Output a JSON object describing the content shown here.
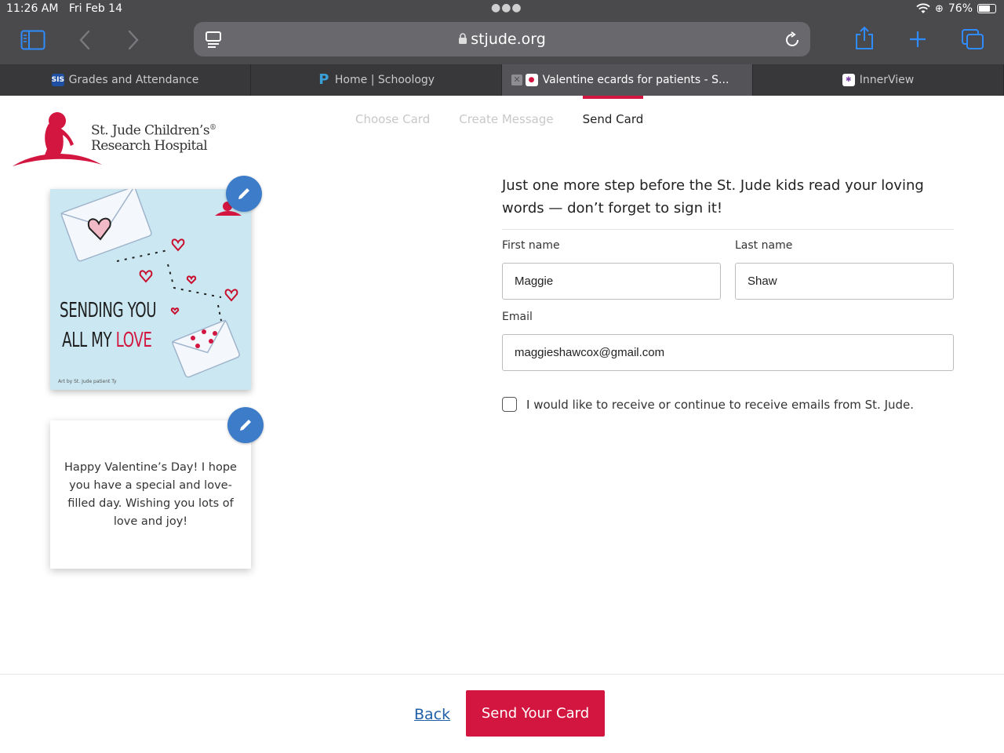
{
  "status": {
    "time": "11:26 AM",
    "date": "Fri Feb 14",
    "battery": "76%",
    "battery_level": 0.76
  },
  "browser": {
    "url": "stjude.org"
  },
  "tabs": [
    {
      "label": "Grades and Attendance",
      "favicon": "SIS"
    },
    {
      "label": "Home | Schoology",
      "favicon": "P"
    },
    {
      "label": "Valentine ecards for patients - S...",
      "favicon": "st-jude-icon",
      "active": true
    },
    {
      "label": "InnerView",
      "favicon": "innerview-icon"
    }
  ],
  "logo": {
    "line1": "St. Jude Children’s",
    "line2": "Research Hospital",
    "mark": "®"
  },
  "steps": [
    {
      "label": "Choose Card"
    },
    {
      "label": "Create Message"
    },
    {
      "label": "Send Card",
      "current": true
    }
  ],
  "card": {
    "art_line1": "SENDING YOU",
    "art_line2_a": "ALL MY ",
    "art_line2_b": "LOVE",
    "art_credit": "Art by St. Jude patient Ty",
    "message": "Happy Valentine’s Day! I hope you have a special and love-filled day. Wishing you lots of love and joy!"
  },
  "form": {
    "intro": "Just one more step before the St. Jude kids read your loving words — don’t forget to sign it!",
    "first_name_label": "First name",
    "first_name_value": "Maggie",
    "last_name_label": "Last name",
    "last_name_value": "Shaw",
    "email_label": "Email",
    "email_value": "maggieshawcox@gmail.com",
    "optin_label": "I would like to receive or continue to receive emails from St. Jude."
  },
  "footer": {
    "back_label": "Back",
    "send_label": "Send Your Card"
  },
  "colors": {
    "brand_red": "#d3163f",
    "edit_blue": "#3d7cc9",
    "ios_blue": "#2f8cff"
  }
}
